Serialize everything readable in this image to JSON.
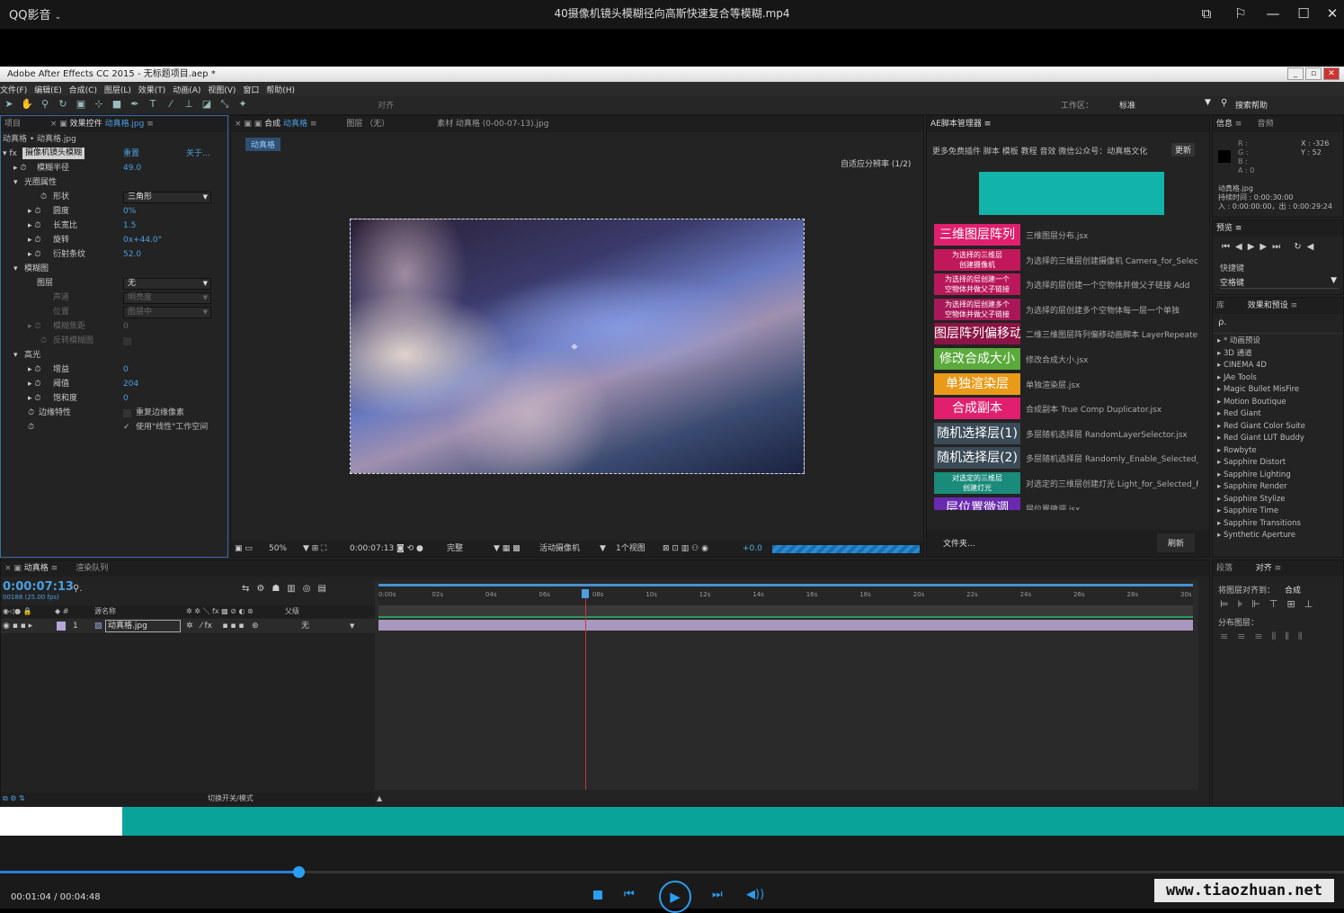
{
  "player": {
    "app_name": "QQ影音",
    "video_title": "40摄像机镜头模糊径向高斯快速复合等模糊.mp4",
    "time_display": "00:01:04 / 00:04:48",
    "progress": 0.222,
    "watermark": "www.tiaozhuan.net"
  },
  "ae": {
    "title": "Adobe After Effects CC 2015 - 无标题项目.aep *",
    "menu": [
      "文件(F)",
      "编辑(E)",
      "合成(C)",
      "图层(L)",
      "效果(T)",
      "动画(A)",
      "视图(V)",
      "窗口",
      "帮助(H)"
    ],
    "toolbar": {
      "align_label": "对齐",
      "workspace_label": "工作区：",
      "workspace_value": "标准",
      "search_help": "搜索帮助"
    },
    "effect_controls": {
      "tabs": {
        "project": "项目",
        "effect_controls": "效果控件",
        "layer_name": "动真格.jpg"
      },
      "breadcrumb": "动真格 • 动真格.jpg",
      "effect_name": "摄像机镜头模糊",
      "reset": "重置",
      "about": "关于...",
      "props": {
        "blur_radius": {
          "label": "模糊半径",
          "value": "49.0"
        },
        "iris_properties": "光圈属性",
        "shape": {
          "label": "形状",
          "value": "三角形"
        },
        "roundness": {
          "label": "圆度",
          "value": "0%"
        },
        "aspect": {
          "label": "长宽比",
          "value": "1.5"
        },
        "rotation": {
          "label": "旋转",
          "value": "0x+44.0°"
        },
        "diffraction": {
          "label": "衍射条纹",
          "value": "52.0"
        },
        "blur_map": "模糊图",
        "layer": {
          "label": "图层",
          "value": "无"
        },
        "channel": {
          "label": "声道",
          "value": "明亮度"
        },
        "placement": {
          "label": "位置",
          "value": "图层中"
        },
        "focal": {
          "label": "模糊焦距",
          "value": "0"
        },
        "invert": "反转模糊图",
        "highlight": "高光",
        "gain": {
          "label": "增益",
          "value": "0"
        },
        "threshold": {
          "label": "阈值",
          "value": "204"
        },
        "saturation": {
          "label": "饱和度",
          "value": "0"
        },
        "edge": {
          "label": "边缘特性",
          "opt": "重复边缘像素"
        },
        "linear": "使用\"线性\"工作空间"
      }
    },
    "composition": {
      "tab_comp": "合成",
      "comp_name": "动真格",
      "tab_layer": "图层 （无）",
      "tab_footage": "素材 动真格 (0-00-07-13).jpg",
      "comp_label": "动真格",
      "res_label": "自适应分辨率 (1/2)",
      "zoom": "50%",
      "timecode": "0:00:07:13",
      "quality": "完整",
      "camera": "活动摄像机",
      "views": "1个视图",
      "exposure": "+0.0"
    },
    "script_panel": {
      "title": "AE脚本管理器",
      "banner": "更多免费插件 脚本 模板 教程 音效 微信公众号：动真格文化",
      "refresh": "更新",
      "items": [
        {
          "btn": "三维图层阵列",
          "desc": "三维图层分布.jsx",
          "color": "#e0206e"
        },
        {
          "btn": "为选择的三维层\n创建摄像机",
          "desc": "为选择的三维层创建摄像机 Camera_for_Selected",
          "color": "#c0185a"
        },
        {
          "btn": "为选择的层创建一个\n空物体并做父子链接",
          "desc": "为选择的层创建一个空物体并做父子链接 Add",
          "color": "#b8185a"
        },
        {
          "btn": "为选择的层创建多个\n空物体并做父子链接",
          "desc": "为选择的层创建多个空物体每一层一个单独",
          "color": "#a81858"
        },
        {
          "btn": "图层阵列偏移动画",
          "desc": "二维三维图层阵列偏移动画脚本 LayerRepeater",
          "color": "#8c1445"
        },
        {
          "btn": "修改合成大小",
          "desc": "修改合成大小.jsx",
          "color": "#5aaa3c"
        },
        {
          "btn": "单独渲染层",
          "desc": "单独渲染层.jsx",
          "color": "#e89a18"
        },
        {
          "btn": "合成副本",
          "desc": "合成副本 True Comp Duplicator.jsx",
          "color": "#e0206e"
        },
        {
          "btn": "随机选择层(1)",
          "desc": "多层随机选择层 RandomLayerSelector.jsx",
          "color": "#3a4a56"
        },
        {
          "btn": "随机选择层(2)",
          "desc": "多层随机选择层 Randomly_Enable_Selected_La",
          "color": "#3a4a56"
        },
        {
          "btn": "对选定的三维层\n创建灯光",
          "desc": "对选定的三维层创建灯光 Light_for_Selected_F",
          "color": "#1a8a7a"
        },
        {
          "btn": "层位置微调",
          "desc": "层位置微调.jsx",
          "color": "#6a2ab0"
        }
      ],
      "folder": "文件夹...",
      "refresh2": "刷新"
    },
    "info": {
      "tab_info": "信息",
      "tab_audio": "音频",
      "r": "R :",
      "g": "G :",
      "b": "B :",
      "a": "A : 0",
      "x": "X : -326",
      "y": "Y : 52",
      "layer": "动真格.jpg",
      "duration": "持续时间 : 0:00:30:00",
      "inout": "入 : 0:00:00:00，出 : 0:00:29:24"
    },
    "preview": {
      "title": "预览",
      "shortcut_label": "快捷键",
      "shortcut_value": "空格键"
    },
    "effects": {
      "tab_lib": "库",
      "title": "效果和预设",
      "search": "ρ.",
      "items": [
        "▸ * 动画预设",
        "▸ 3D 通道",
        "▸ CINEMA 4D",
        "▸ JAe Tools",
        "▸ Magic Bullet MisFire",
        "▸ Motion Boutique",
        "▸ Red Giant",
        "▸ Red Giant Color Suite",
        "▸ Red Giant LUT Buddy",
        "▸ Rowbyte",
        "▸ Sapphire Distort",
        "▸ Sapphire Lighting",
        "▸ Sapphire Render",
        "▸ Sapphire Stylize",
        "▸ Sapphire Time",
        "▸ Sapphire Transitions",
        "▸ Synthetic Aperture"
      ]
    },
    "align": {
      "tab_para": "段落",
      "tab_align": "对齐",
      "align_to": "将图层对齐到：",
      "align_target": "合成",
      "distribute": "分布图层："
    },
    "timeline": {
      "tab_comp": "动真格",
      "tab_render": "渲染队列",
      "timecode": "0:00:07:13",
      "frames": "00188 (25.00 fps)",
      "col_name": "源名称",
      "col_parent": "父级",
      "layer_num": "1",
      "layer_name": "动真格.jpg",
      "parent_value": "无",
      "toggle": "切换开关/模式",
      "ticks": [
        "0:00s",
        "02s",
        "04s",
        "06s",
        "08s",
        "10s",
        "12s",
        "14s",
        "16s",
        "18s",
        "20s",
        "22s",
        "24s",
        "26s",
        "28s",
        "30s"
      ],
      "playhead_sec": 7.52
    }
  }
}
